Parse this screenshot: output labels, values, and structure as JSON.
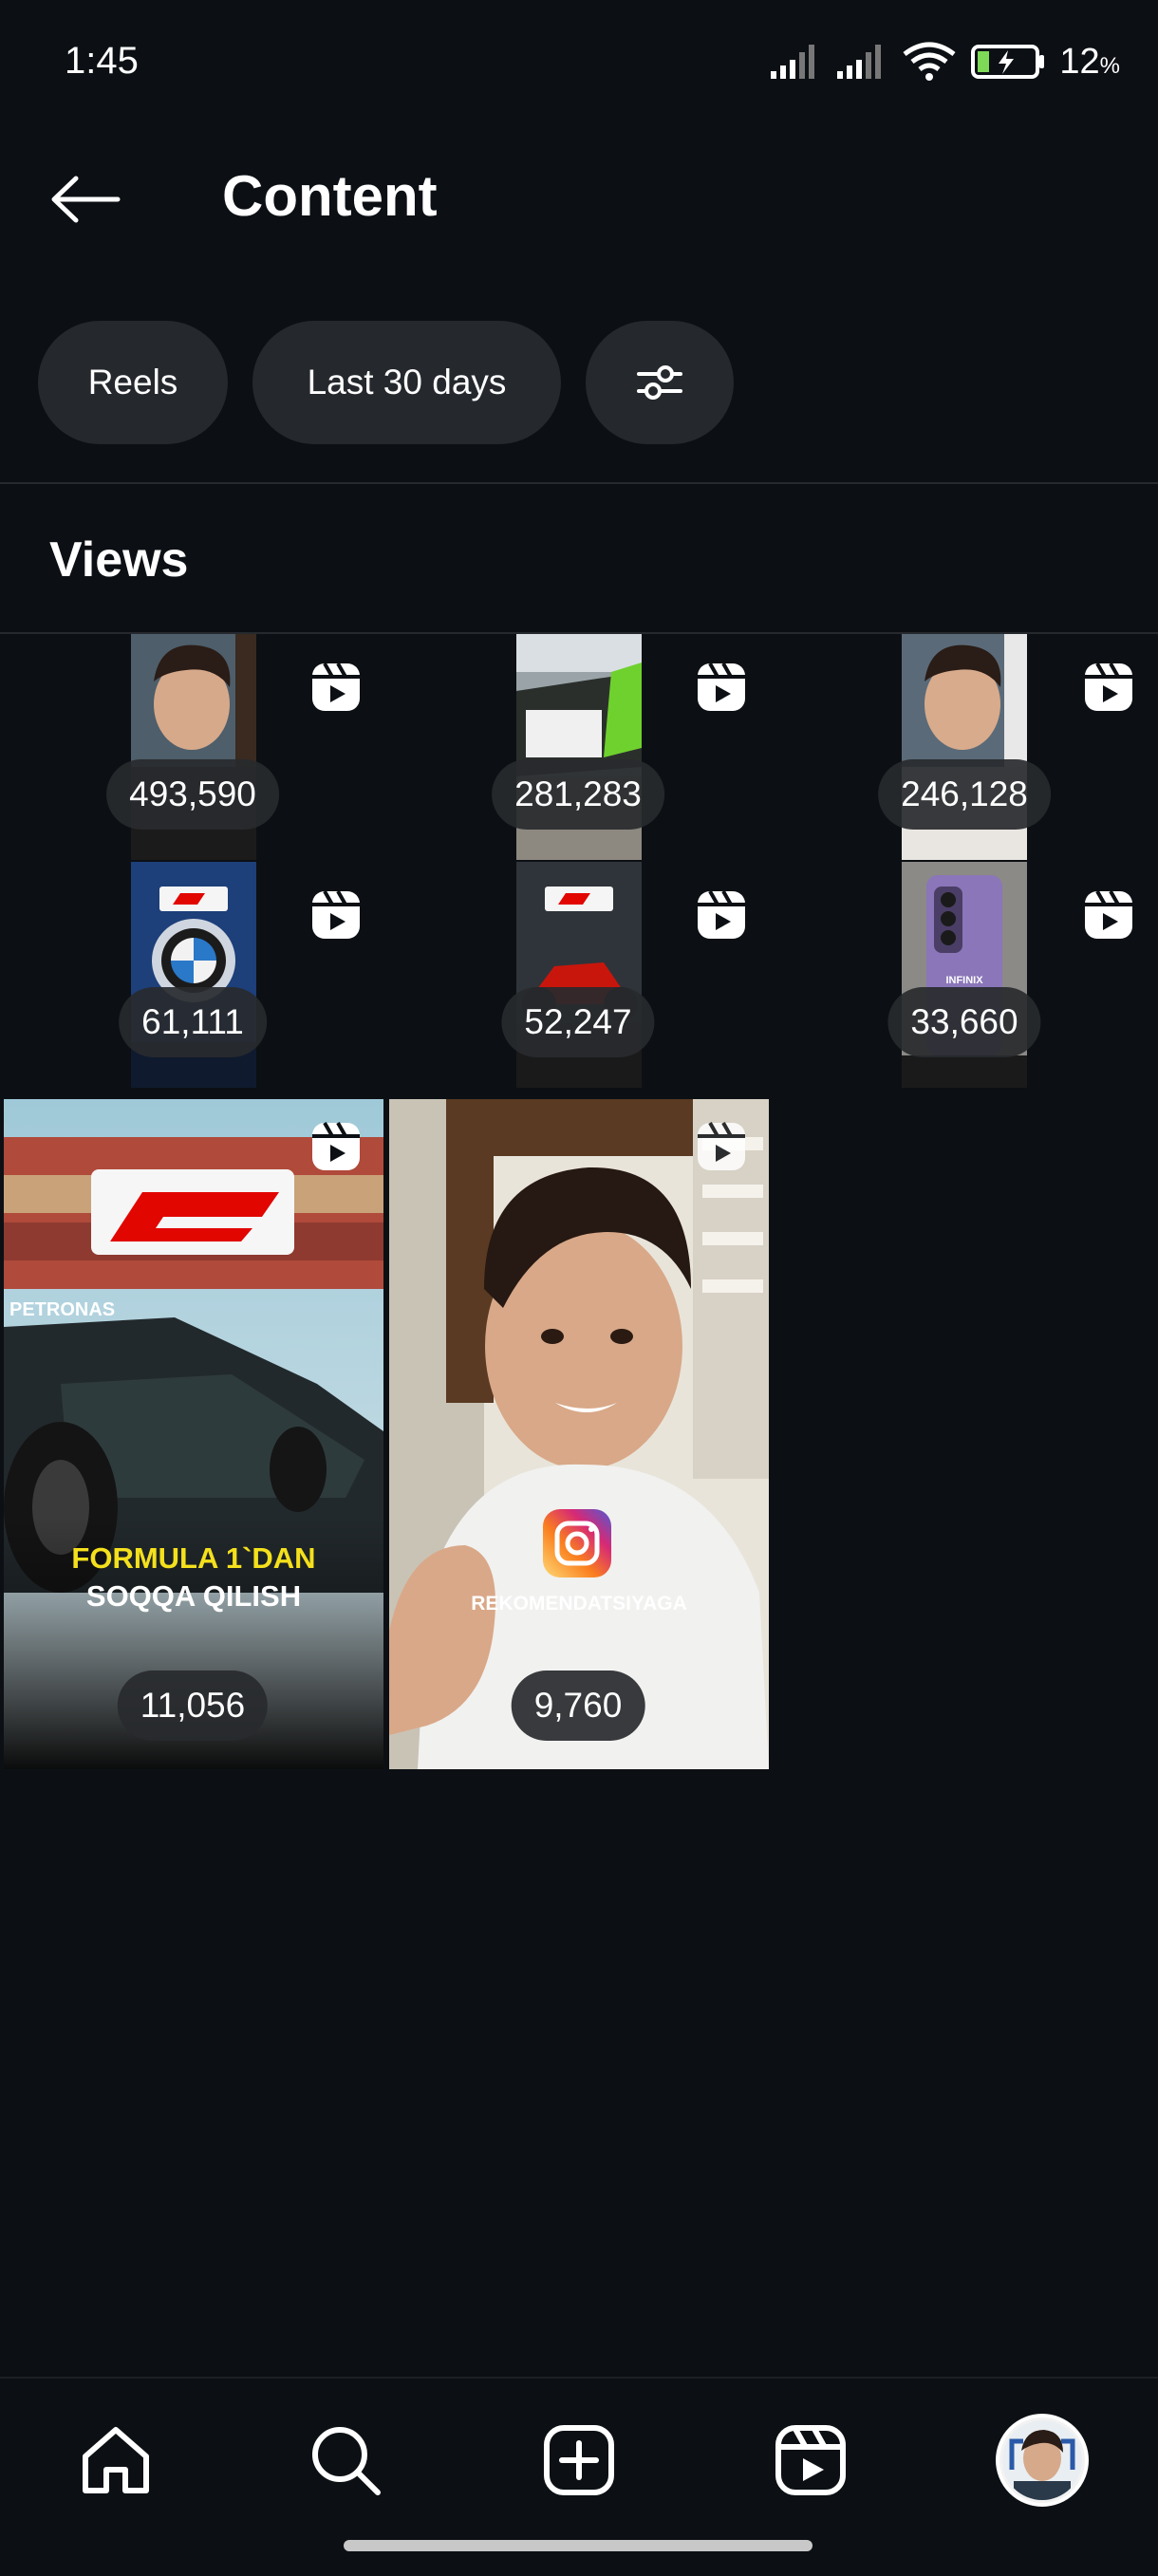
{
  "status_bar": {
    "time": "1:45",
    "battery_percent": "12",
    "battery_unit": "%"
  },
  "header": {
    "title": "Content"
  },
  "filters": {
    "type_label": "Reels",
    "period_label": "Last 30 days"
  },
  "section": {
    "title": "Views"
  },
  "reels": [
    {
      "views": "493,590",
      "icon": "reels-icon"
    },
    {
      "views": "281,283",
      "icon": "reels-icon"
    },
    {
      "views": "246,128",
      "icon": "reels-icon"
    },
    {
      "views": "61,111",
      "icon": "reels-icon"
    },
    {
      "views": "52,247",
      "icon": "reels-icon"
    },
    {
      "views": "33,660",
      "icon": "reels-icon"
    },
    {
      "views": "11,056",
      "icon": "reels-icon"
    },
    {
      "views": "9,760",
      "icon": "reels-icon"
    }
  ],
  "thumbnail_text": {
    "bmw": "BMW",
    "phone_brand": "INFINIX",
    "f1_caption_line1": "FORMULA 1`DAN",
    "f1_caption_line2": "SOQQA QILISH",
    "f1_car_brand": "PETRONAS",
    "ig_caption": "REKOMENDATSIYAGA"
  },
  "bottom_nav": [
    {
      "name": "home",
      "icon": "home-icon"
    },
    {
      "name": "search",
      "icon": "search-icon"
    },
    {
      "name": "create",
      "icon": "plus-square-icon"
    },
    {
      "name": "reels",
      "icon": "reels-icon"
    },
    {
      "name": "profile",
      "icon": "avatar"
    }
  ],
  "colors": {
    "background": "#0c1014",
    "chip": "#25292e",
    "pill": "#282a2e",
    "f1_red": "#e10600",
    "caption_yellow": "#f4e01c"
  }
}
